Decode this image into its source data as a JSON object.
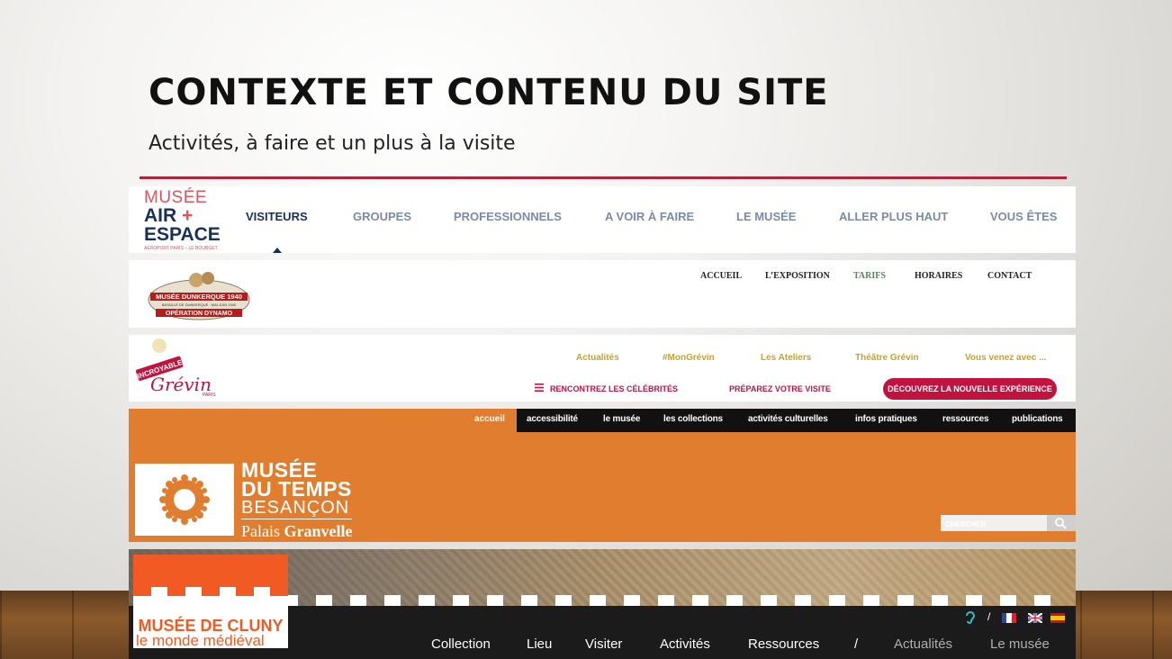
{
  "slide": {
    "title": "CONTEXTE ET CONTENU DU SITE",
    "subtitle": "Activités, à faire et un plus à la visite"
  },
  "air_espace": {
    "logo": {
      "musee": "MUSÉE",
      "air": "AIR",
      "plus": "+",
      "espace": "ESPACE",
      "tagline": "AÉROPORT PARIS – LE BOURGET"
    },
    "nav": [
      "VISITEURS",
      "GROUPES",
      "PROFESSIONNELS",
      "A VOIR À FAIRE",
      "LE MUSÉE",
      "ALLER PLUS HAUT",
      "VOUS ÊTES"
    ]
  },
  "dunkerque": {
    "logo": {
      "name": "MUSÉE DUNKERQUE 1940",
      "band": "BATAILLE DE DUNKERQUE · MAI-JUIN 1940",
      "operation": "OPÉRATION DYNAMO"
    },
    "nav": [
      "ACCUEIL",
      "L’EXPOSITION",
      "TARIFS",
      "HORAIRES",
      "CONTACT"
    ]
  },
  "grevin": {
    "logo": {
      "incroyable": "INCROYABLE",
      "name": "Grévin",
      "city": "PARIS"
    },
    "top_nav": [
      "Actualités",
      "#MonGrévin",
      "Les Ateliers",
      "Théâtre Grévin",
      "Vous venez avec ..."
    ],
    "sub_nav": [
      "RENCONTREZ LES CÉLÉBRITÉS",
      "PRÉPAREZ VOTRE VISITE"
    ],
    "cta": "DÉCOUVREZ LA NOUVELLE EXPÉRIENCE"
  },
  "musee_temps": {
    "nav_home": "accueil",
    "nav": [
      "accessibilité",
      "le musée",
      "les collections",
      "activités culturelles",
      "infos pratiques",
      "ressources",
      "publications"
    ],
    "name": {
      "l1": "MUSÉE",
      "l2": "DU TEMPS",
      "l3": "BESANÇON",
      "l4a": "Palais ",
      "l4b": "Granvelle"
    },
    "search_placeholder": "CHERCHER"
  },
  "cluny": {
    "logo": {
      "title": "MUSÉE DE CLUNY",
      "subtitle": "le monde médiéval"
    },
    "nav": [
      "Collection",
      "Lieu",
      "Visiter",
      "Activités",
      "Ressources"
    ],
    "separator": "/",
    "secondary_nav": [
      "Actualités",
      "Le musée"
    ],
    "util_separator": "/",
    "colors": {
      "brand": "#f15a22"
    }
  }
}
